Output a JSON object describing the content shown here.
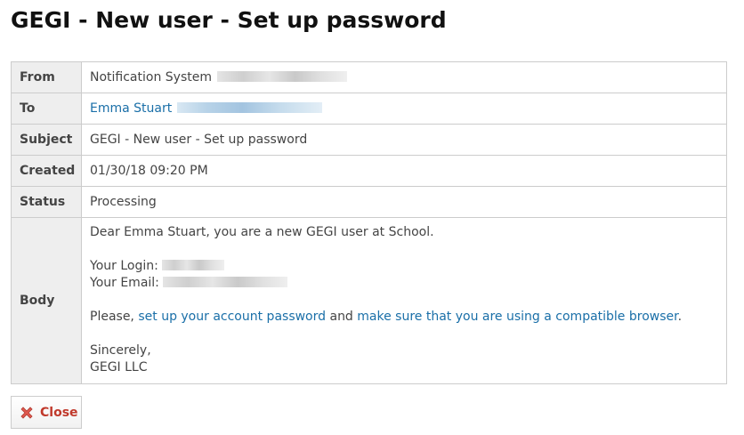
{
  "page": {
    "title": "GEGI - New user - Set up password"
  },
  "details": {
    "from_label": "From",
    "from_value": "Notification System",
    "to_label": "To",
    "to_value": "Emma Stuart",
    "subject_label": "Subject",
    "subject_value": "GEGI - New user - Set up password",
    "created_label": "Created",
    "created_value": "01/30/18 09:20 PM",
    "status_label": "Status",
    "status_value": "Processing",
    "body_label": "Body"
  },
  "body": {
    "greeting": "Dear Emma Stuart, you are a new GEGI user at School.",
    "login_label": "Your Login:",
    "email_label": "Your Email:",
    "please_prefix": "Please,",
    "setup_link": "set up your account password",
    "and_text": "and",
    "browser_link": "make sure that you are using a compatible browser",
    "period": ".",
    "closing": "Sincerely,",
    "signature": "GEGI LLC"
  },
  "actions": {
    "close_label": "Close",
    "close_icon": "close-x-icon",
    "close_icon_color": "#d9534f"
  },
  "colors": {
    "link": "#1a6fa8",
    "label_bg": "#eeeeee",
    "border": "#cccccc"
  }
}
